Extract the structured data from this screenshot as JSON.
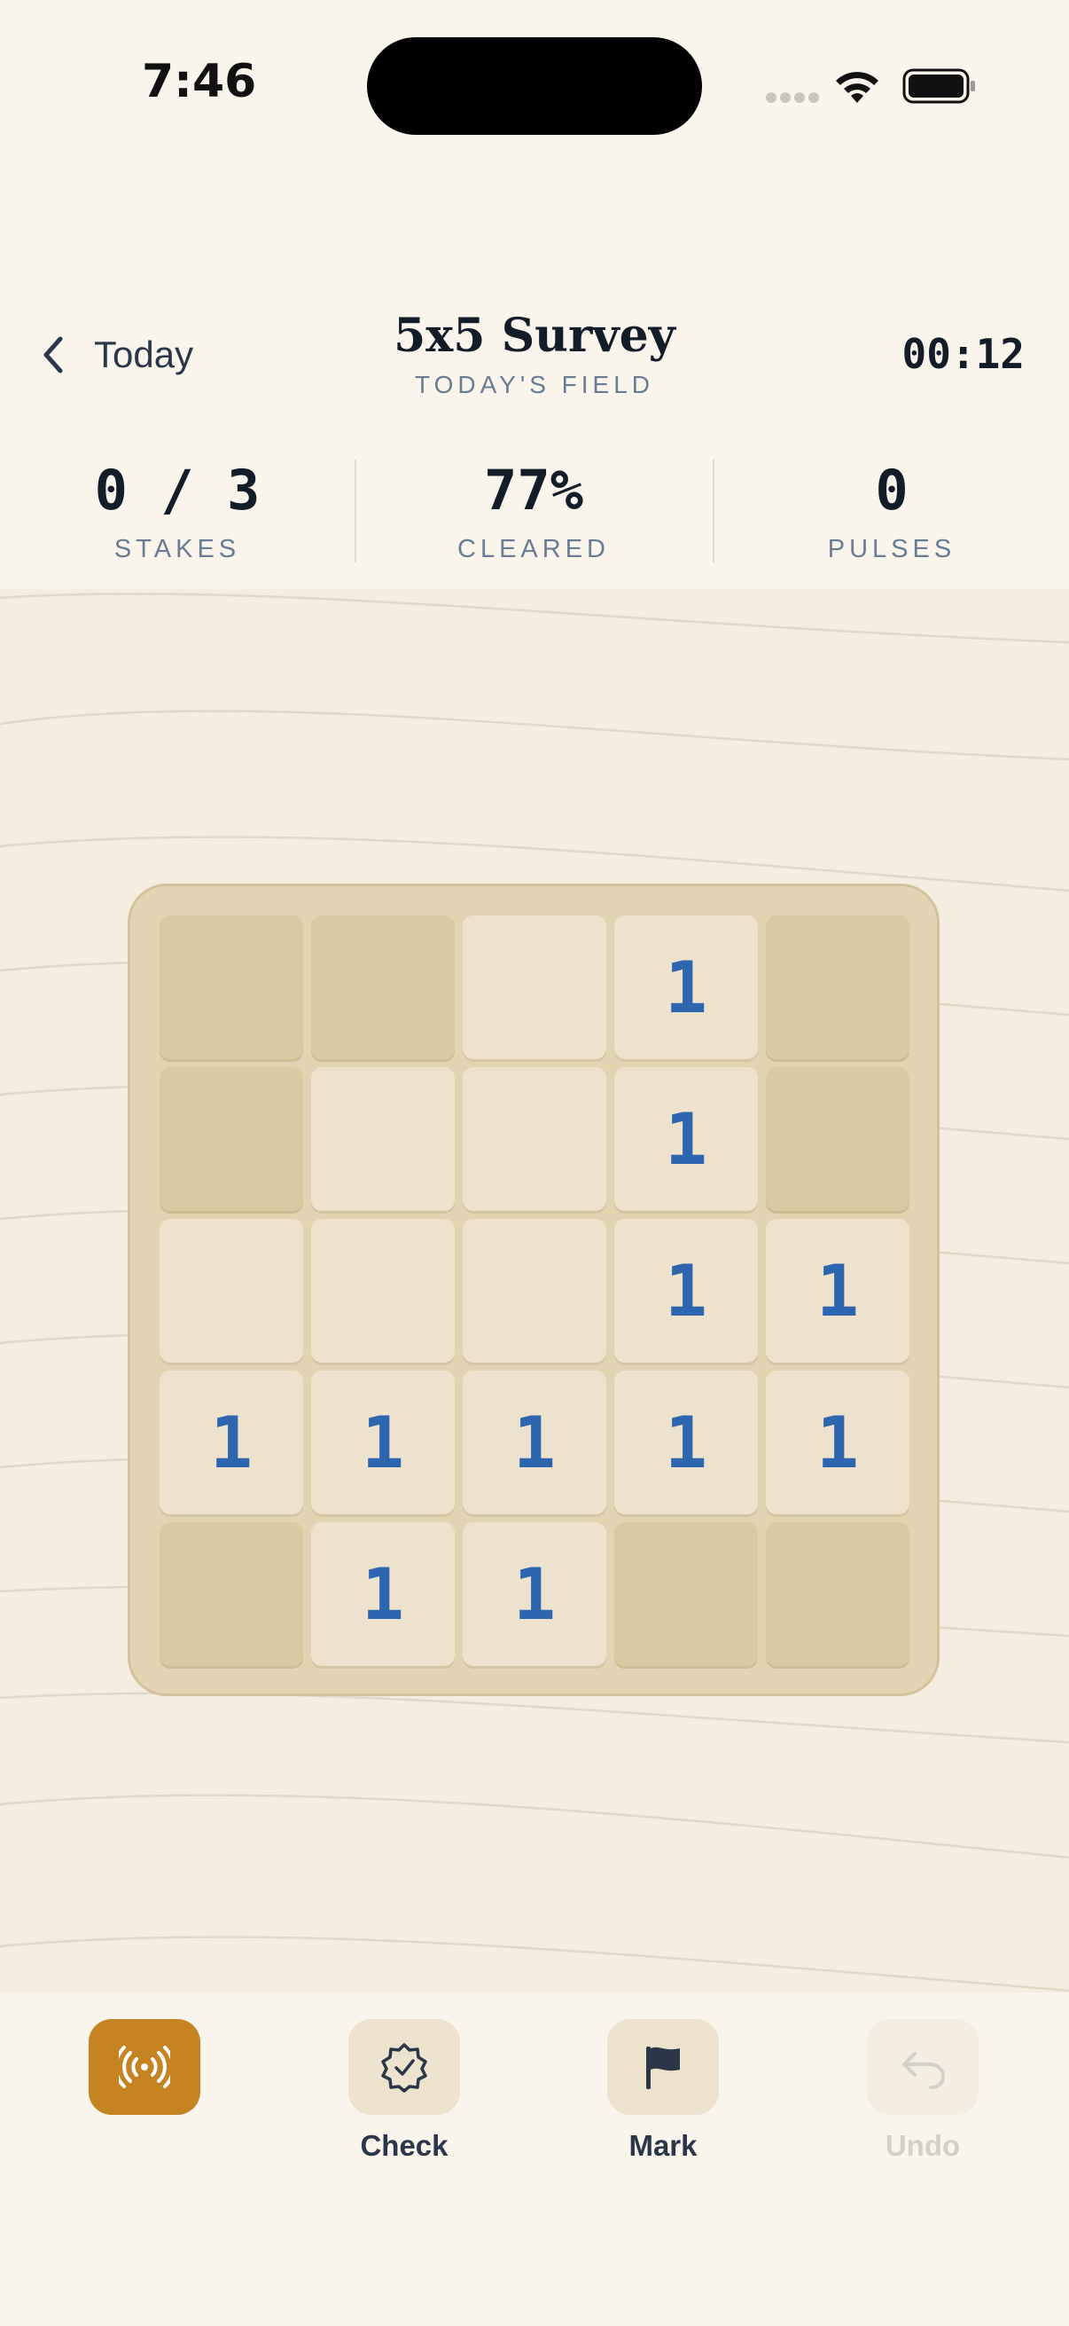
{
  "status_bar": {
    "time": "7:46",
    "icons": [
      "signal-dots-icon",
      "wifi-icon",
      "battery-icon"
    ]
  },
  "header": {
    "back_label": "Today",
    "title": "5x5 Survey",
    "subtitle": "TODAY'S FIELD",
    "timer": "00:12"
  },
  "stats": [
    {
      "value": "0 / 3",
      "label": "STAKES"
    },
    {
      "value": "77%",
      "label": "CLEARED"
    },
    {
      "value": "0",
      "label": "PULSES"
    }
  ],
  "board": {
    "size": 5,
    "cells": [
      [
        "hidden",
        "hidden",
        "",
        "1",
        "hidden"
      ],
      [
        "hidden",
        "",
        "",
        "1",
        "hidden"
      ],
      [
        "",
        "",
        "",
        "1",
        "1"
      ],
      [
        "1",
        "1",
        "1",
        "1",
        "1"
      ],
      [
        "hidden",
        "1",
        "1",
        "hidden",
        "hidden"
      ]
    ]
  },
  "toolbar": {
    "pulse": {
      "label": "",
      "icon": "pulse-broadcast-icon"
    },
    "check": {
      "label": "Check",
      "icon": "badge-check-icon"
    },
    "mark": {
      "label": "Mark",
      "icon": "flag-icon"
    },
    "undo": {
      "label": "Undo",
      "icon": "undo-icon",
      "disabled": true
    }
  },
  "colors": {
    "background": "#F9F5EC",
    "accent": "#C58322",
    "number": "#2D66AE",
    "hidden_cell": "#D9CAA3",
    "revealed_cell": "#EDE2CE"
  }
}
